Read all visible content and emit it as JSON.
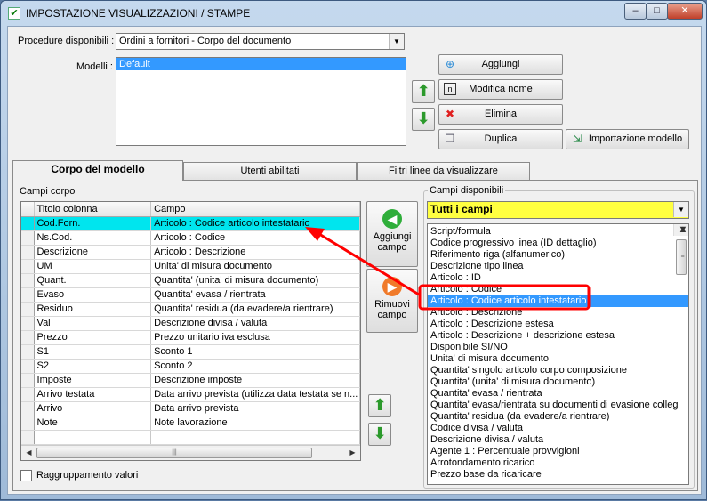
{
  "window": {
    "title": "IMPOSTAZIONE VISUALIZZAZIONI / STAMPE",
    "min_glyph": "–",
    "max_glyph": "□",
    "close_glyph": "✕"
  },
  "procedure": {
    "label": "Procedure disponibili :",
    "value": "Ordini a fornitori - Corpo del documento"
  },
  "modelli": {
    "label": "Modelli :",
    "items": [
      "Default"
    ]
  },
  "buttons": {
    "aggiungi": "Aggiungi",
    "modifica_nome": "Modifica nome",
    "elimina": "Elimina",
    "duplica": "Duplica",
    "importazione_modello": "Importazione modello"
  },
  "tabs": [
    "Corpo del modello",
    "Utenti abilitati",
    "Filtri linee da visualizzare"
  ],
  "campi_corpo": {
    "label": "Campi corpo",
    "columns": [
      "Titolo colonna",
      "Campo"
    ],
    "rows": [
      [
        "Cod.Forn.",
        "Articolo : Codice articolo intestatario"
      ],
      [
        "Ns.Cod.",
        "Articolo : Codice"
      ],
      [
        "Descrizione",
        "Articolo : Descrizione"
      ],
      [
        "UM",
        "Unita' di misura documento"
      ],
      [
        "Quant.",
        "Quantita' (unita' di misura documento)"
      ],
      [
        "Evaso",
        "Quantita' evasa / rientrata"
      ],
      [
        "Residuo",
        "Quantita' residua (da evadere/a rientrare)"
      ],
      [
        "Val",
        "Descrizione divisa / valuta"
      ],
      [
        "Prezzo",
        "Prezzo unitario iva esclusa"
      ],
      [
        "S1",
        "Sconto 1"
      ],
      [
        "S2",
        "Sconto 2"
      ],
      [
        "Imposte",
        "Descrizione imposte"
      ],
      [
        "Arrivo testata",
        "Data arrivo prevista (utilizza data testata se n..."
      ],
      [
        "Arrivo",
        "Data arrivo prevista"
      ],
      [
        "Note",
        "Note lavorazione"
      ],
      [
        "",
        ""
      ]
    ]
  },
  "side_buttons": {
    "aggiungi_campo": "Aggiungi campo",
    "rimuovi_campo": "Rimuovi campo"
  },
  "raggruppamento": {
    "label": "Raggruppamento valori",
    "checked": false
  },
  "campi_disponibili": {
    "label": "Campi disponibili",
    "filter_value": "Tutti i campi",
    "items": [
      "Script/formula",
      "Codice progressivo linea (ID dettaglio)",
      "Riferimento riga (alfanumerico)",
      "Descrizione tipo linea",
      "Articolo : ID",
      "Articolo : Codice",
      "Articolo : Codice articolo intestatario",
      "Articolo : Descrizione",
      "Articolo : Descrizione estesa",
      "Articolo : Descrizione + descrizione estesa",
      "Disponibile SI/NO",
      "Unita' di misura documento",
      "Quantita' singolo articolo corpo composizione",
      "Quantita' (unita' di misura documento)",
      "Quantita' evasa / rientrata",
      "Quantita' evasa/rientrata su documenti di evasione colleg",
      "Quantita' residua (da evadere/a rientrare)",
      "Codice divisa / valuta",
      "Descrizione divisa / valuta",
      "Agente 1 : Percentuale provvigioni",
      "Arrotondamento ricarico",
      "Prezzo base da ricaricare"
    ],
    "selected_index": 6
  },
  "colors": {
    "highlight_row": "#00e5ee",
    "selection": "#3399ff",
    "annotation": "#ff0000",
    "filter_combo": "#ffff40"
  }
}
